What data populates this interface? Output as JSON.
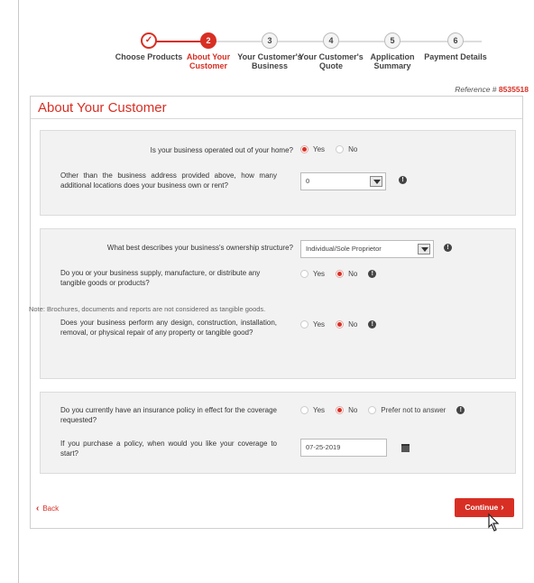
{
  "stepper": {
    "steps": [
      {
        "num": "✓",
        "label": "Choose Products",
        "state": "done"
      },
      {
        "num": "2",
        "label": "About Your Customer",
        "state": "active"
      },
      {
        "num": "3",
        "label": "Your Customer's Business",
        "state": "pending"
      },
      {
        "num": "4",
        "label": "Your Customer's Quote",
        "state": "pending"
      },
      {
        "num": "5",
        "label": "Application Summary",
        "state": "pending"
      },
      {
        "num": "6",
        "label": "Payment Details",
        "state": "pending"
      }
    ]
  },
  "reference": {
    "label": "Reference #",
    "number": "8535518"
  },
  "page_title": "About Your Customer",
  "section1": {
    "q_home": "Is your business operated out of your home?",
    "home_yes": "Yes",
    "home_no": "No",
    "q_locations": "Other than the business address provided above, how many additional locations does your business own or rent?",
    "locations_value": "0"
  },
  "section2": {
    "q_ownership": "What best describes your business's ownership structure?",
    "ownership_value": "Individual/Sole Proprietor",
    "q_goods": "Do you or your business supply, manufacture, or distribute any tangible goods or products?",
    "goods_yes": "Yes",
    "goods_no": "No",
    "note": "Note: Brochures, documents and reports are not considered as tangible goods.",
    "q_repair": "Does your business perform any design, construction, installation, removal, or physical repair of any property or tangible good?",
    "repair_yes": "Yes",
    "repair_no": "No"
  },
  "section3": {
    "q_policy": "Do you currently have an insurance policy in effect for the coverage requested?",
    "policy_yes": "Yes",
    "policy_no": "No",
    "policy_prefer": "Prefer not to answer",
    "q_start": "If you purchase a policy, when would you like your coverage to start?",
    "start_date": "07-25-2019"
  },
  "nav": {
    "back": "Back",
    "continue": "Continue"
  },
  "colors": {
    "accent": "#d82f24",
    "panel_bg": "#f2f2f2"
  },
  "icons": {
    "info": "info-icon",
    "calendar": "calendar-icon",
    "check": "check-icon"
  }
}
